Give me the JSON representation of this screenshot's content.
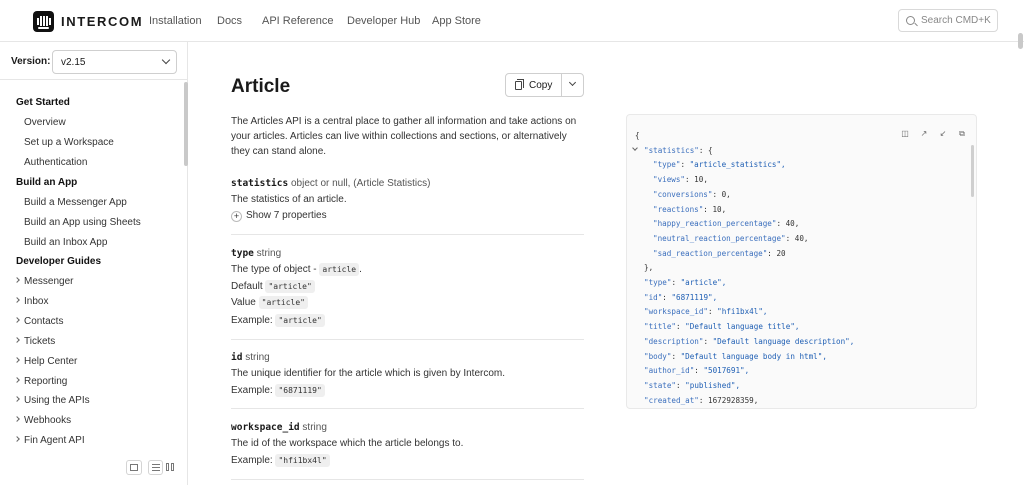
{
  "header": {
    "brand": "INTERCOM",
    "nav": [
      "Installation",
      "Docs",
      "API Reference",
      "Developer Hub",
      "App Store"
    ],
    "search_placeholder": "Search",
    "search_shortcut": "CMD+K"
  },
  "sidebar": {
    "version_label": "Version:",
    "version_value": "v2.15",
    "sections": [
      {
        "title": "Get Started",
        "items": [
          "Overview",
          "Set up a Workspace",
          "Authentication"
        ]
      },
      {
        "title": "Build an App",
        "items": [
          "Build a Messenger App",
          "Build an App using Sheets",
          "Build an Inbox App"
        ]
      },
      {
        "title": "Developer Guides",
        "items": [
          "Messenger",
          "Inbox",
          "Contacts",
          "Tickets",
          "Help Center",
          "Reporting",
          "Using the APIs",
          "Webhooks",
          "Fin Agent API"
        ]
      }
    ]
  },
  "main": {
    "title": "Article",
    "copy_label": "Copy",
    "intro": "The Articles API is a central place to gather all information and take actions on your articles. Articles can live within collections and sections, or alternatively they can stand alone.",
    "properties": {
      "statistics": {
        "name": "statistics",
        "type": "object or null, (Article Statistics)",
        "description": "The statistics of an article.",
        "show_more": "Show 7 properties"
      },
      "type": {
        "name": "type",
        "type": "string",
        "description": "The type of object -",
        "desc_code": "article",
        "desc_end": ".",
        "default_label": "Default",
        "default_value": "\"article\"",
        "value_label": "Value",
        "value_value": "\"article\"",
        "example_label": "Example:",
        "example_value": "\"article\""
      },
      "id": {
        "name": "id",
        "type": "string",
        "description": "The unique identifier for the article which is given by Intercom.",
        "example_label": "Example:",
        "example_value": "\"6871119\""
      },
      "workspace_id": {
        "name": "workspace_id",
        "type": "string",
        "description": "The id of the workspace which the article belongs to.",
        "example_label": "Example:",
        "example_value": "\"hfi1bx4l\""
      }
    }
  },
  "code_sample": {
    "lines": [
      "{",
      "\"statistics\": {",
      "\"type\": \"article_statistics\",",
      "\"views\": 10,",
      "\"conversions\": 0,",
      "\"reactions\": 10,",
      "\"happy_reaction_percentage\": 40,",
      "\"neutral_reaction_percentage\": 40,",
      "\"sad_reaction_percentage\": 20",
      "},",
      "\"type\": \"article\",",
      "\"id\": \"6871119\",",
      "\"workspace_id\": \"hfi1bx4l\",",
      "\"title\": \"Default language title\",",
      "\"description\": \"Default language description\",",
      "\"body\": \"Default language body in html\",",
      "\"author_id\": \"5017691\",",
      "\"state\": \"published\",",
      "\"created_at\": 1672928359,"
    ]
  }
}
